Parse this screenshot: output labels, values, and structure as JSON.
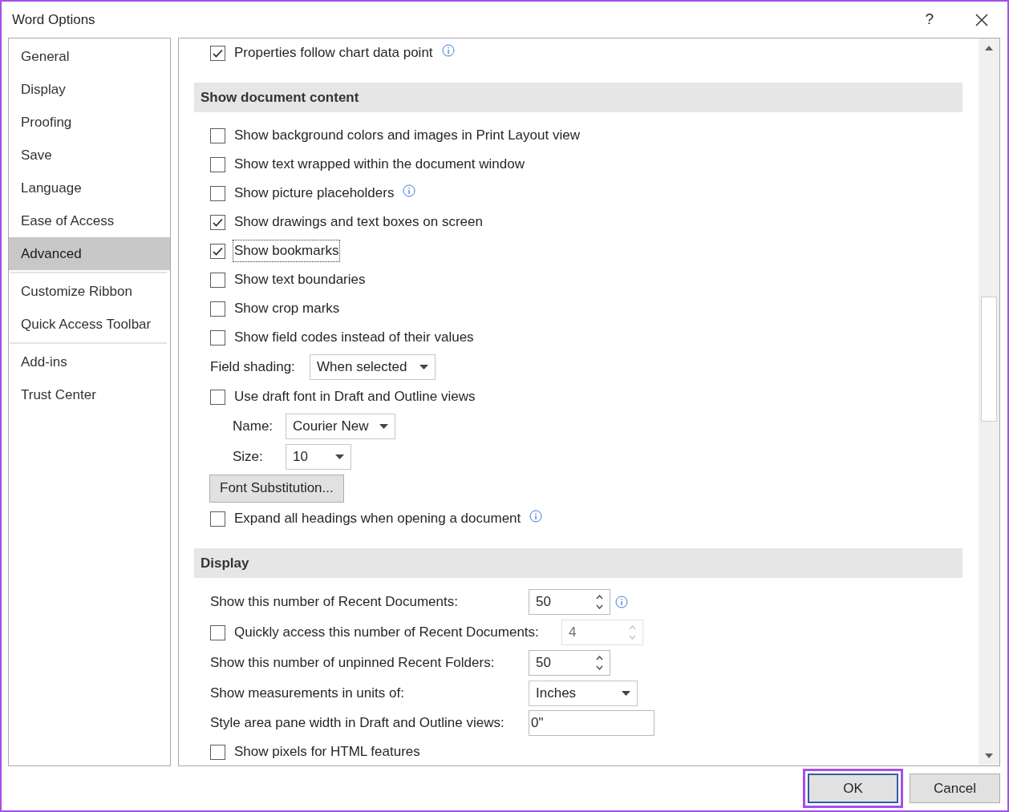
{
  "window": {
    "title": "Word Options",
    "help": "?"
  },
  "sidebar": {
    "groups": [
      [
        {
          "label": "General",
          "selected": false
        },
        {
          "label": "Display",
          "selected": false
        },
        {
          "label": "Proofing",
          "selected": false
        },
        {
          "label": "Save",
          "selected": false
        },
        {
          "label": "Language",
          "selected": false
        },
        {
          "label": "Ease of Access",
          "selected": false
        },
        {
          "label": "Advanced",
          "selected": true
        }
      ],
      [
        {
          "label": "Customize Ribbon",
          "selected": false
        },
        {
          "label": "Quick Access Toolbar",
          "selected": false
        }
      ],
      [
        {
          "label": "Add-ins",
          "selected": false
        },
        {
          "label": "Trust Center",
          "selected": false
        }
      ]
    ]
  },
  "content": [
    {
      "kind": "checkbox",
      "label": "Properties follow chart data point",
      "checked": true,
      "info": true,
      "focused": false
    },
    {
      "kind": "section",
      "title": "Show document content"
    },
    {
      "kind": "checkbox",
      "label": "Show background colors and images in Print Layout view",
      "checked": false,
      "info": false,
      "focused": false
    },
    {
      "kind": "checkbox",
      "label": "Show text wrapped within the document window",
      "checked": false,
      "info": false,
      "focused": false
    },
    {
      "kind": "checkbox",
      "label": "Show picture placeholders",
      "checked": false,
      "info": true,
      "focused": false
    },
    {
      "kind": "checkbox",
      "label": "Show drawings and text boxes on screen",
      "checked": true,
      "info": false,
      "focused": false
    },
    {
      "kind": "checkbox",
      "label": "Show bookmarks",
      "checked": true,
      "info": false,
      "focused": true
    },
    {
      "kind": "checkbox",
      "label": "Show text boundaries",
      "checked": false,
      "info": false,
      "focused": false
    },
    {
      "kind": "checkbox",
      "label": "Show crop marks",
      "checked": false,
      "info": false,
      "focused": false
    },
    {
      "kind": "checkbox",
      "label": "Show field codes instead of their values",
      "checked": false,
      "info": false,
      "focused": false
    },
    {
      "kind": "dropdown",
      "label": "Field shading:",
      "value": "When selected"
    },
    {
      "kind": "checkbox",
      "label": "Use draft font in Draft and Outline views",
      "checked": false,
      "info": false,
      "focused": false,
      "children": [
        {
          "kind": "dropdown",
          "label": "Name:",
          "value": "Courier New"
        },
        {
          "kind": "dropdown",
          "label": "Size:",
          "value": "10"
        }
      ]
    },
    {
      "kind": "button",
      "label": "Font Substitution..."
    },
    {
      "kind": "checkbox",
      "label": "Expand all headings when opening a document",
      "checked": false,
      "info": true,
      "focused": false
    },
    {
      "kind": "section",
      "title": "Display"
    },
    {
      "kind": "spin",
      "label": "Show this number of Recent Documents:",
      "value": "50",
      "disabled": false,
      "info": true
    },
    {
      "kind": "checkbox_spin",
      "label": "Quickly access this number of Recent Documents:",
      "checked": false,
      "value": "4",
      "disabled": true
    },
    {
      "kind": "spin",
      "label": "Show this number of unpinned Recent Folders:",
      "value": "50",
      "disabled": false,
      "info": false
    },
    {
      "kind": "dropdown",
      "label": "Show measurements in units of:",
      "value": "Inches"
    },
    {
      "kind": "text_input",
      "label": "Style area pane width in Draft and Outline views:",
      "value": "0\""
    },
    {
      "kind": "checkbox",
      "label": "Show pixels for HTML features",
      "checked": false,
      "info": false,
      "focused": false
    }
  ],
  "buttons": [
    {
      "label": "OK",
      "default": true,
      "highlighted": true
    },
    {
      "label": "Cancel",
      "default": false,
      "highlighted": false
    }
  ]
}
